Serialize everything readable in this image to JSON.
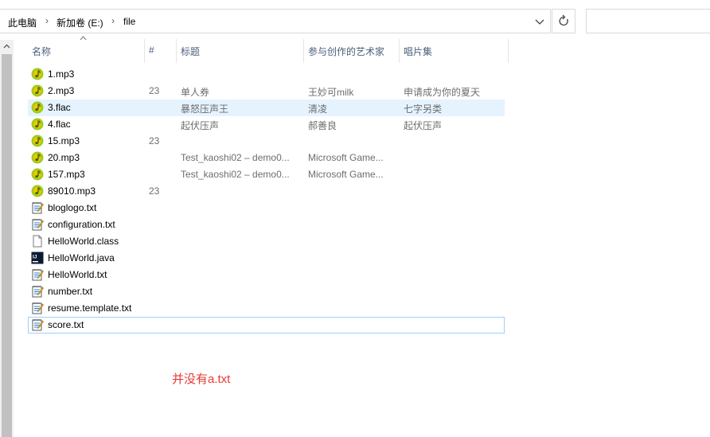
{
  "breadcrumb": {
    "items": [
      "此电脑",
      "新加卷 (E:)",
      "file"
    ]
  },
  "columns": [
    "名称",
    "#",
    "标题",
    "参与创作的艺术家",
    "唱片集"
  ],
  "files": [
    {
      "name": "1.mp3",
      "num": "",
      "title": "",
      "artist": "",
      "album": "",
      "icon": "music-note-icon",
      "state": "normal"
    },
    {
      "name": "2.mp3",
      "num": "23",
      "title": "单人券",
      "artist": "王妙可milk",
      "album": "申请成为你的夏天",
      "icon": "music-note-icon",
      "state": "normal"
    },
    {
      "name": "3.flac",
      "num": "",
      "title": "暴怒压声王",
      "artist": "清凌",
      "album": "七字另类",
      "icon": "music-note-icon",
      "state": "selected"
    },
    {
      "name": "4.flac",
      "num": "",
      "title": "起伏压声",
      "artist": "郝善良",
      "album": "起伏压声",
      "icon": "music-note-icon",
      "state": "normal"
    },
    {
      "name": "15.mp3",
      "num": "23",
      "title": "",
      "artist": "",
      "album": "",
      "icon": "music-note-icon",
      "state": "normal"
    },
    {
      "name": "20.mp3",
      "num": "",
      "title": "Test_kaoshi02 – demo0...",
      "artist": "Microsoft Game...",
      "album": "",
      "icon": "music-note-icon",
      "state": "normal"
    },
    {
      "name": "157.mp3",
      "num": "",
      "title": "Test_kaoshi02 – demo0...",
      "artist": "Microsoft Game...",
      "album": "",
      "icon": "music-note-icon",
      "state": "normal"
    },
    {
      "name": "89010.mp3",
      "num": "23",
      "title": "",
      "artist": "",
      "album": "",
      "icon": "music-note-icon",
      "state": "normal"
    },
    {
      "name": "bloglogo.txt",
      "num": "",
      "title": "",
      "artist": "",
      "album": "",
      "icon": "notepad-icon",
      "state": "normal"
    },
    {
      "name": "configuration.txt",
      "num": "",
      "title": "",
      "artist": "",
      "album": "",
      "icon": "notepad-icon",
      "state": "normal"
    },
    {
      "name": "HelloWorld.class",
      "num": "",
      "title": "",
      "artist": "",
      "album": "",
      "icon": "blank-file-icon",
      "state": "normal"
    },
    {
      "name": "HelloWorld.java",
      "num": "",
      "title": "",
      "artist": "",
      "album": "",
      "icon": "intellij-icon",
      "state": "normal"
    },
    {
      "name": "HelloWorld.txt",
      "num": "",
      "title": "",
      "artist": "",
      "album": "",
      "icon": "notepad-icon",
      "state": "normal"
    },
    {
      "name": "number.txt",
      "num": "",
      "title": "",
      "artist": "",
      "album": "",
      "icon": "notepad-icon",
      "state": "normal"
    },
    {
      "name": "resume.template.txt",
      "num": "",
      "title": "",
      "artist": "",
      "album": "",
      "icon": "notepad-icon",
      "state": "normal"
    },
    {
      "name": "score.txt",
      "num": "",
      "title": "",
      "artist": "",
      "album": "",
      "icon": "notepad-icon",
      "state": "focused"
    }
  ],
  "annotation": "并没有a.txt",
  "colors": {
    "header_text": "#4c607a",
    "selected_bg": "#e5f3ff",
    "focus_border": "#99d1ff",
    "annotation": "#e53935",
    "music_icon_green": "#9ccc1c",
    "music_icon_yellow": "#f5c400"
  }
}
